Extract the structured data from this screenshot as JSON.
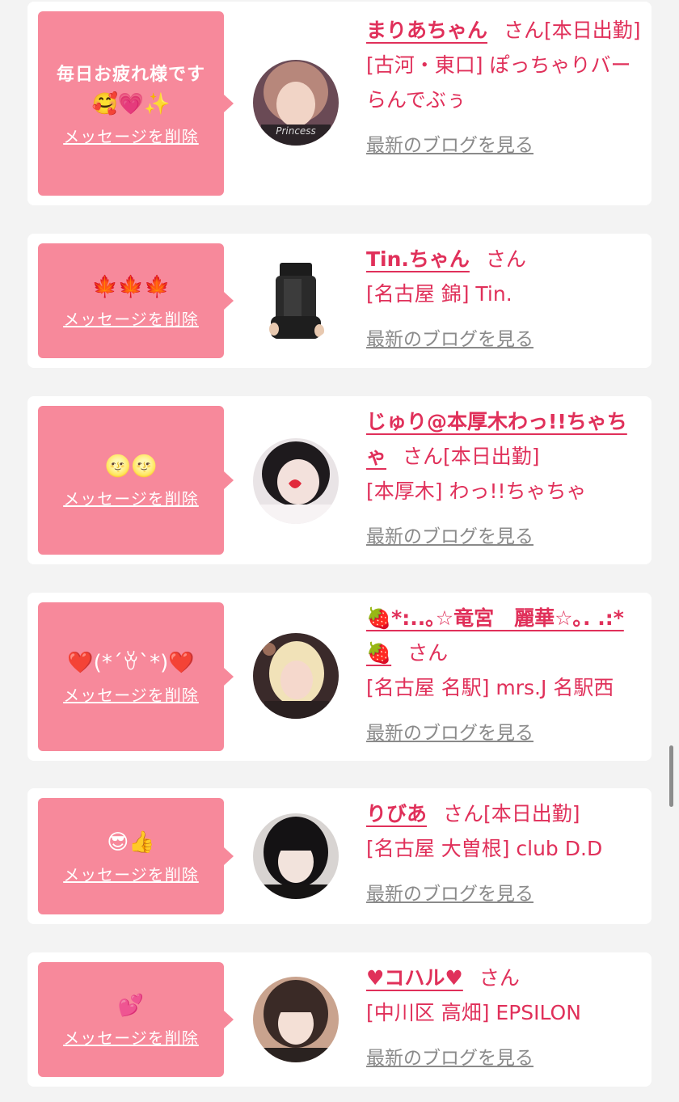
{
  "common": {
    "delete_label": "メッセージを削除",
    "blog_label": "最新のブログを見る"
  },
  "cards": [
    {
      "message": "毎日お疲れ様です",
      "emoji": "🥰💗✨",
      "name": "まりあちゃん",
      "suffix": "さん[本日出勤]",
      "shop": "[古河・東口] ぽっちゃりバー らんでぶぅ"
    },
    {
      "message": "",
      "emoji": "🍁🍁🍁",
      "name": "Tin.ちゃん",
      "suffix": "さん",
      "shop": "[名古屋 錦] Tin."
    },
    {
      "message": "",
      "emoji": "🌝🌝",
      "name": "じゅり@本厚木わっ!!ちゃちゃ",
      "suffix": "さん[本日出勤]",
      "shop": "[本厚木] わっ!!ちゃちゃ"
    },
    {
      "message": "",
      "emoji": "❤️(*´ꈊ`*)❤️",
      "name": "🍓*:..｡☆竜宮　麗華☆｡. .:*🍓",
      "suffix": "さん",
      "shop": "[名古屋 名駅] mrs.J 名駅西"
    },
    {
      "message": "",
      "emoji": "😎👍",
      "name": "りびあ",
      "suffix": "さん[本日出勤]",
      "shop": "[名古屋 大曽根] club D.D"
    },
    {
      "message": "",
      "emoji": "💕",
      "name": "♥コハル♥",
      "suffix": "さん",
      "shop": "[中川区 高畑] EPSILON"
    }
  ]
}
